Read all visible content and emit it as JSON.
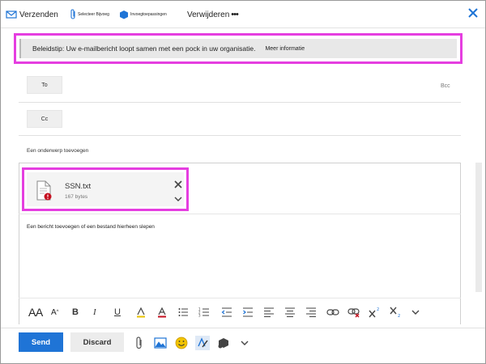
{
  "toolbar": {
    "send_label": "Verzenden",
    "attach_label": "Selecteer Bijvoeg",
    "addins_label": "Invoegtoepassingen",
    "delete_label": "Verwijderen",
    "more_label": "•••"
  },
  "policy_tip": {
    "text": "Beleidstip: Uw e-mailbericht loopt samen met een pock in uw organisatie.",
    "more_info": "Meer informatie"
  },
  "recipients": {
    "to_label": "To",
    "cc_label": "Cc",
    "bcc_label": "Bcc"
  },
  "subject": {
    "placeholder": "Een onderwerp toevoegen"
  },
  "attachment": {
    "name": "SSN.txt",
    "size": "167 bytes"
  },
  "body": {
    "placeholder": "Een bericht toevoegen of een bestand hierheen slepen"
  },
  "format_toolbar": {
    "font_size_label": "AA",
    "font_grow_label": "A",
    "bold_label": "B",
    "italic_label": "I",
    "underline_label": "U"
  },
  "actions": {
    "send_label": "Send",
    "discard_label": "Discard"
  },
  "colors": {
    "accent": "#1f74d6",
    "highlight": "#e53ee0",
    "error": "#c50f1f"
  },
  "icons": [
    "send-icon",
    "paperclip-icon",
    "addins-icon",
    "close-icon",
    "file-icon",
    "error-badge-icon",
    "chevron-down-icon",
    "highlight-icon",
    "font-color-icon",
    "bullets-icon",
    "numbering-icon",
    "outdent-icon",
    "indent-icon",
    "align-left-icon",
    "align-center-icon",
    "align-right-icon",
    "link-icon",
    "remove-link-icon",
    "superscript-icon",
    "subscript-icon",
    "image-icon",
    "emoji-icon",
    "signature-icon"
  ]
}
